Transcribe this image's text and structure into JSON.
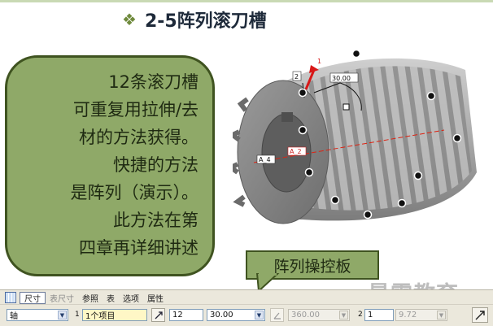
{
  "slide": {
    "title": "2-5阵列滚刀槽",
    "bullet_icon": "diamond-cluster-icon",
    "accent_color": "#8fa968",
    "callout_text": "12条滚刀槽\n可重复用拉伸/去\n材的方法获得。\n快捷的方法\n是阵列（演示）。\n此方法在第\n四章再详细讲述",
    "panel_label": "阵列操控板",
    "watermark": "最需教育"
  },
  "model": {
    "labels": {
      "dim_angle": "30.00",
      "dim_count": "2",
      "axis_left": "A_4",
      "axis_right": "A_2",
      "dir_num": "1"
    }
  },
  "dashboard": {
    "tabs": [
      {
        "label": "尺寸",
        "active": true,
        "disabled": false
      },
      {
        "label": "表尺寸",
        "active": false,
        "disabled": true
      },
      {
        "label": "参照",
        "active": false,
        "disabled": false
      },
      {
        "label": "表",
        "active": false,
        "disabled": false
      },
      {
        "label": "选项",
        "active": false,
        "disabled": false
      },
      {
        "label": "属性",
        "active": false,
        "disabled": false
      }
    ],
    "pattern_type": "轴",
    "dir1_number": "1",
    "dir1_collector": "1个项目",
    "count_members": "12",
    "angle_value": "30.00",
    "angular_extent": "360.00",
    "dir2_number": "2",
    "dir2_count": "1",
    "dir2_angle": "9.72"
  }
}
